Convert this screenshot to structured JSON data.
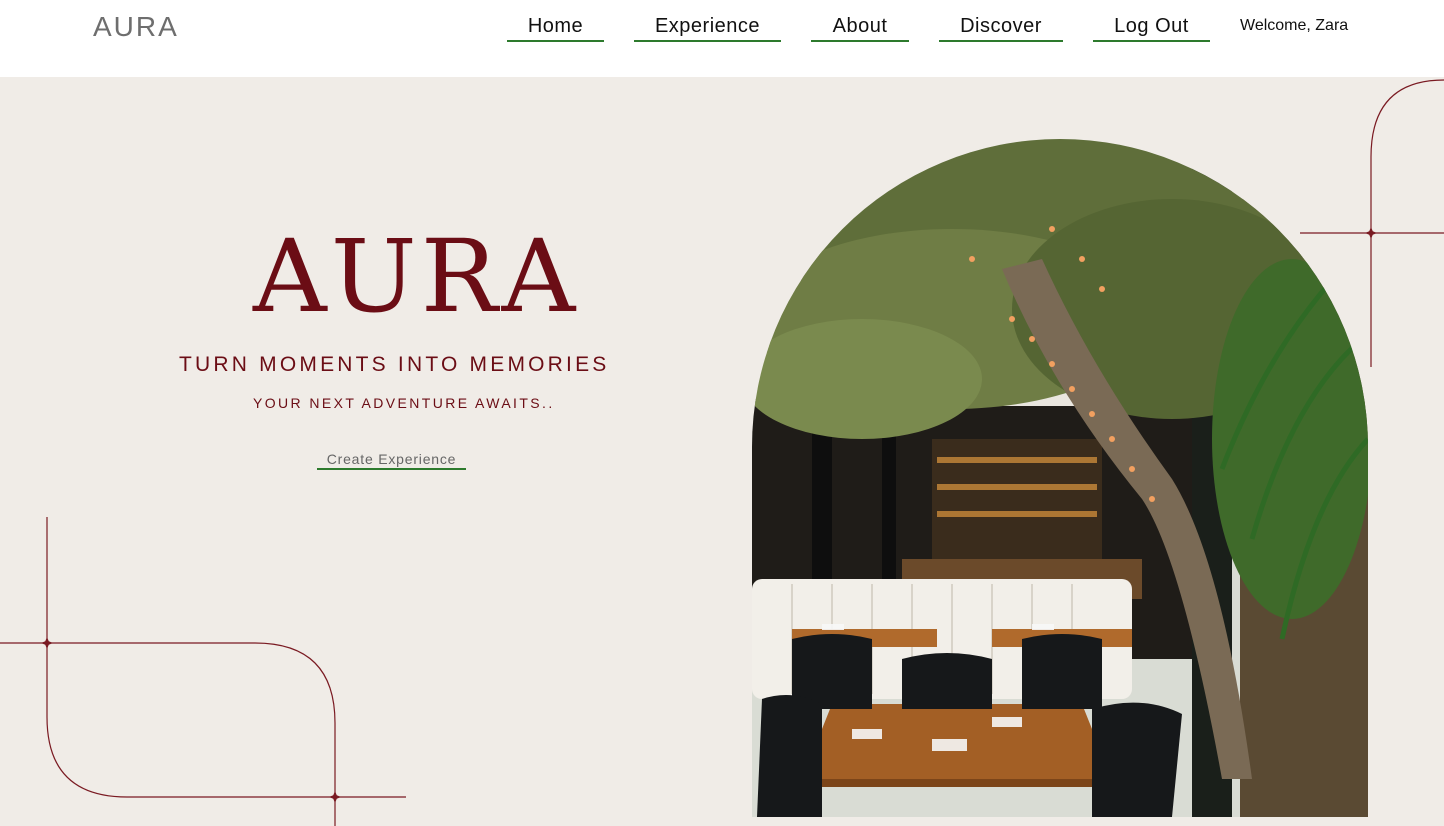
{
  "header": {
    "brand": "AURA",
    "nav": [
      {
        "label": "Home"
      },
      {
        "label": "Experience"
      },
      {
        "label": "About"
      },
      {
        "label": "Discover"
      },
      {
        "label": "Log Out"
      }
    ],
    "welcome": "Welcome, Zara"
  },
  "hero": {
    "logo": "AURA",
    "tagline": "TURN MOMENTS INTO MEMORIES",
    "subtagline": "YOUR NEXT ADVENTURE AWAITS..",
    "cta_label": "Create Experience"
  },
  "colors": {
    "accent": "#6b0d15",
    "underline": "#2d7a2d",
    "background": "#f0ece7"
  }
}
